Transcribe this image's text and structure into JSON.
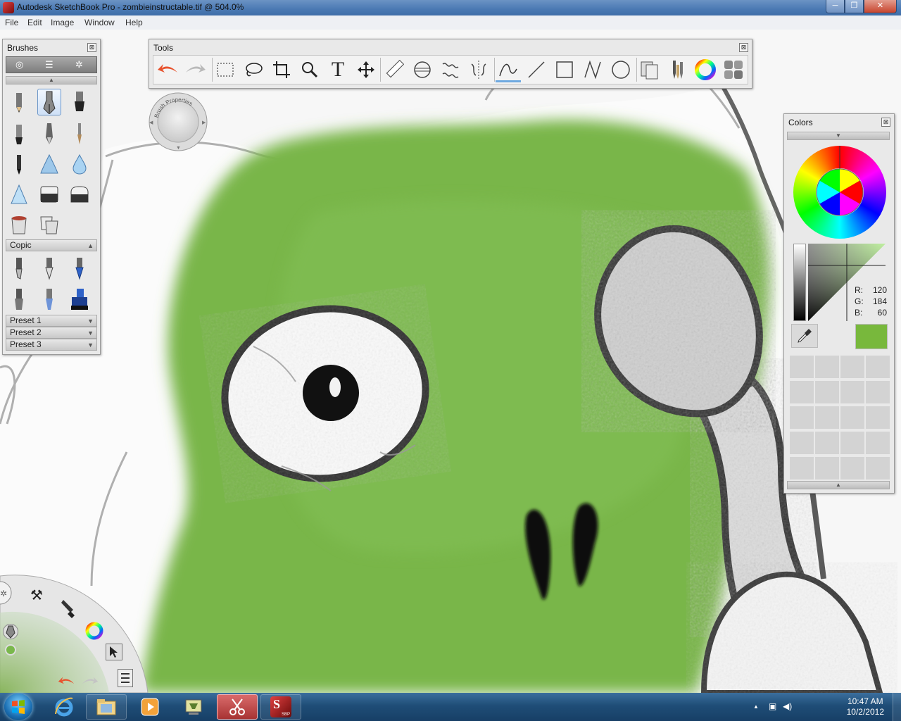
{
  "window": {
    "title": "Autodesk SketchBook Pro - zombieinstructable.tif @ 504.0%",
    "minimize": "─",
    "maximize": "❐",
    "close": "✕"
  },
  "menu": [
    "File",
    "Edit",
    "Image",
    "Window",
    "Help"
  ],
  "brushes_panel": {
    "title": "Brushes",
    "close": "⊠",
    "sections": [
      {
        "label": "Copic",
        "caret": "▲"
      },
      {
        "label": "Preset 1",
        "caret": "▼"
      },
      {
        "label": "Preset 2",
        "caret": "▼"
      },
      {
        "label": "Preset 3",
        "caret": "▼"
      }
    ]
  },
  "tools_panel": {
    "title": "Tools",
    "close": "⊠",
    "text_tool": "T"
  },
  "brush_properties": {
    "label": "Brush Properties"
  },
  "colors_panel": {
    "title": "Colors",
    "close": "⊠",
    "r_label": "R:",
    "r": "120",
    "g_label": "G:",
    "g": "184",
    "b_label": "B:",
    "b": "60",
    "current_color": "#78b83c"
  },
  "taskbar": {
    "time": "10:47 AM",
    "date": "10/2/2012",
    "show_hidden": "▲",
    "sbp_label": "SBP"
  },
  "colors": {
    "zombie_green": "#79b64a",
    "title_blue": "#4a79b3",
    "undo_red": "#e8532e"
  }
}
